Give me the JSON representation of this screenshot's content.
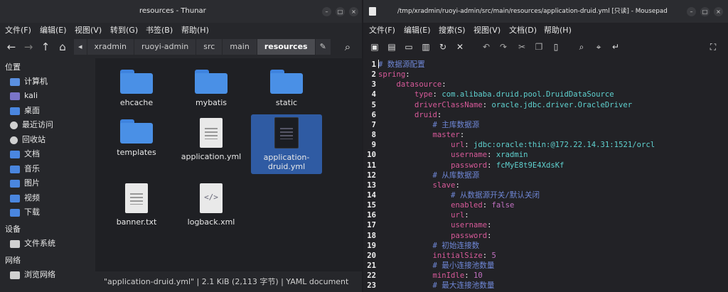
{
  "thunar": {
    "title": "resources - Thunar",
    "window_buttons": [
      "–",
      "□",
      "×"
    ],
    "menu": [
      "文件(F)",
      "编辑(E)",
      "视图(V)",
      "转到(G)",
      "书签(B)",
      "帮助(H)"
    ],
    "breadcrumbs": [
      "xradmin",
      "ruoyi-admin",
      "src",
      "main",
      "resources"
    ],
    "sidebar": {
      "places_header": "位置",
      "places": [
        {
          "label": "计算机",
          "icon": "computer-icon",
          "color": "#5a8fe0"
        },
        {
          "label": "kali",
          "icon": "home-folder-icon",
          "color": "#7a74c8"
        },
        {
          "label": "桌面",
          "icon": "desktop-icon",
          "color": "#4a86df"
        },
        {
          "label": "最近访问",
          "icon": "recent-icon",
          "color": "#d0d0d0"
        },
        {
          "label": "回收站",
          "icon": "trash-icon",
          "color": "#d0d0d0"
        },
        {
          "label": "文档",
          "icon": "documents-folder-icon",
          "color": "#4a86df"
        },
        {
          "label": "音乐",
          "icon": "music-folder-icon",
          "color": "#4a86df"
        },
        {
          "label": "图片",
          "icon": "pictures-folder-icon",
          "color": "#4a86df"
        },
        {
          "label": "视频",
          "icon": "videos-folder-icon",
          "color": "#4a86df"
        },
        {
          "label": "下载",
          "icon": "downloads-folder-icon",
          "color": "#4a86df"
        }
      ],
      "devices_header": "设备",
      "devices": [
        {
          "label": "文件系统",
          "icon": "drive-icon",
          "color": "#d0d0d0"
        }
      ],
      "network_header": "网络",
      "network": [
        {
          "label": "浏览网络",
          "icon": "network-icon",
          "color": "#d0d0d0"
        }
      ]
    },
    "files": [
      {
        "name": "ehcache",
        "type": "folder"
      },
      {
        "name": "mybatis",
        "type": "folder"
      },
      {
        "name": "static",
        "type": "folder"
      },
      {
        "name": "templates",
        "type": "folder"
      },
      {
        "name": "application.yml",
        "type": "text"
      },
      {
        "name": "application-druid.yml",
        "type": "text",
        "selected": true
      },
      {
        "name": "banner.txt",
        "type": "text"
      },
      {
        "name": "logback.xml",
        "type": "xml"
      }
    ],
    "status": "\"application-druid.yml\" | 2.1 KiB (2,113 字节) | YAML document"
  },
  "mousepad": {
    "title": "/tmp/xradmin/ruoyi-admin/src/main/resources/application-druid.yml [只读] - Mousepad",
    "window_buttons": [
      "–",
      "□",
      "×"
    ],
    "menu": [
      "文件(F)",
      "编辑(E)",
      "搜索(S)",
      "视图(V)",
      "文档(D)",
      "帮助(H)"
    ],
    "toolbar": [
      "new-document",
      "new-window",
      "save",
      "save-as",
      "reload",
      "close",
      "undo",
      "redo",
      "cut",
      "copy",
      "paste",
      "find",
      "find-replace",
      "go-to-line",
      "fullscreen"
    ],
    "lines": [
      [
        {
          "t": "# 数据源配置",
          "c": "c"
        }
      ],
      [
        {
          "t": "spring",
          "c": "k"
        },
        {
          "t": ":"
        }
      ],
      [
        {
          "t": "    "
        },
        {
          "t": "datasource",
          "c": "k"
        },
        {
          "t": ":"
        }
      ],
      [
        {
          "t": "        "
        },
        {
          "t": "type",
          "c": "k"
        },
        {
          "t": ": "
        },
        {
          "t": "com.alibaba.druid.pool.DruidDataSource",
          "c": "v"
        }
      ],
      [
        {
          "t": "        "
        },
        {
          "t": "driverClassName",
          "c": "k"
        },
        {
          "t": ": "
        },
        {
          "t": "oracle.jdbc.driver.OracleDriver",
          "c": "v"
        }
      ],
      [
        {
          "t": "        "
        },
        {
          "t": "druid",
          "c": "k"
        },
        {
          "t": ":"
        }
      ],
      [
        {
          "t": "            "
        },
        {
          "t": "# 主库数据源",
          "c": "c"
        }
      ],
      [
        {
          "t": "            "
        },
        {
          "t": "master",
          "c": "k"
        },
        {
          "t": ":"
        }
      ],
      [
        {
          "t": "                "
        },
        {
          "t": "url",
          "c": "k"
        },
        {
          "t": ": "
        },
        {
          "t": "jdbc:oracle:thin:@172.22.14.31:1521/orcl",
          "c": "v"
        }
      ],
      [
        {
          "t": "                "
        },
        {
          "t": "username",
          "c": "k"
        },
        {
          "t": ": "
        },
        {
          "t": "xradmin",
          "c": "v"
        }
      ],
      [
        {
          "t": "                "
        },
        {
          "t": "password",
          "c": "k"
        },
        {
          "t": ": "
        },
        {
          "t": "fcMyE8t9E4XdsKf",
          "c": "v"
        }
      ],
      [
        {
          "t": "            "
        },
        {
          "t": "# 从库数据源",
          "c": "c"
        }
      ],
      [
        {
          "t": "            "
        },
        {
          "t": "slave",
          "c": "k"
        },
        {
          "t": ":"
        }
      ],
      [
        {
          "t": "                "
        },
        {
          "t": "# 从数据源开关/默认关闭",
          "c": "c"
        }
      ],
      [
        {
          "t": "                "
        },
        {
          "t": "enabled",
          "c": "k"
        },
        {
          "t": ": "
        },
        {
          "t": "false",
          "c": "b"
        }
      ],
      [
        {
          "t": "                "
        },
        {
          "t": "url",
          "c": "k"
        },
        {
          "t": ":"
        }
      ],
      [
        {
          "t": "                "
        },
        {
          "t": "username",
          "c": "k"
        },
        {
          "t": ":"
        }
      ],
      [
        {
          "t": "                "
        },
        {
          "t": "password",
          "c": "k"
        },
        {
          "t": ":"
        }
      ],
      [
        {
          "t": "            "
        },
        {
          "t": "# 初始连接数",
          "c": "c"
        }
      ],
      [
        {
          "t": "            "
        },
        {
          "t": "initialSize",
          "c": "k"
        },
        {
          "t": ": "
        },
        {
          "t": "5",
          "c": "n"
        }
      ],
      [
        {
          "t": "            "
        },
        {
          "t": "# 最小连接池数量",
          "c": "c"
        }
      ],
      [
        {
          "t": "            "
        },
        {
          "t": "minIdle",
          "c": "k"
        },
        {
          "t": ": "
        },
        {
          "t": "10",
          "c": "n"
        }
      ],
      [
        {
          "t": "            "
        },
        {
          "t": "# 最大连接池数量",
          "c": "c"
        }
      ]
    ]
  }
}
